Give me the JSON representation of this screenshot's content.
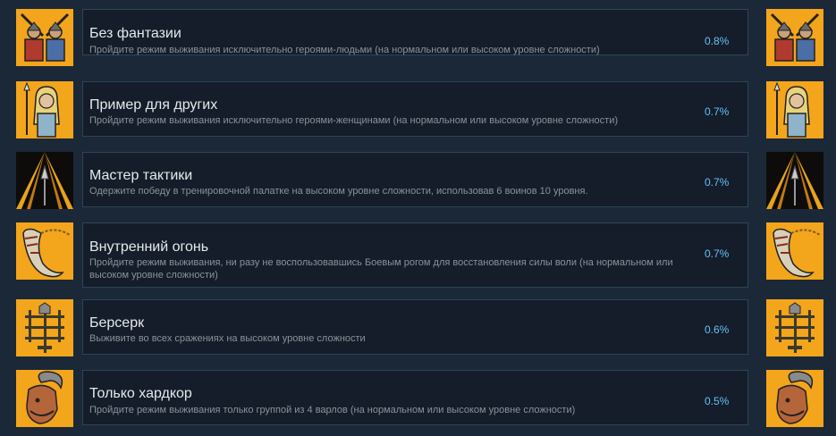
{
  "achievements": [
    {
      "title": "Без фантазии",
      "desc": "Пройдите режим выживания исключительно героями-людьми (на нормальном или высоком уровне сложности)",
      "percent": "0.8%",
      "icon": "two-warriors-icon"
    },
    {
      "title": "Пример для других",
      "desc": "Пройдите режим выживания исключительно героями-женщинами (на нормальном или высоком уровне сложности)",
      "percent": "0.7%",
      "icon": "shieldmaiden-icon"
    },
    {
      "title": "Мастер тактики",
      "desc": "Одержите победу в тренировочной палатке на высоком уровне сложности, использовав 6 воинов 10 уровня.",
      "percent": "0.7%",
      "icon": "spear-tent-icon"
    },
    {
      "title": "Внутренний огонь",
      "desc": "Пройдите режим выживания, ни разу не воспользовавшись Боевым рогом для восстановления силы воли (на нормальном или высоком уровне сложности)",
      "percent": "0.7%",
      "icon": "war-horn-icon"
    },
    {
      "title": "Берсерк",
      "desc": "Выживите во всех сражениях на высоком уровне сложности",
      "percent": "0.6%",
      "icon": "axe-rack-icon"
    },
    {
      "title": "Только хардкор",
      "desc": "Пройдите режим выживания только группой из 4 варлов (на нормальном или высоком уровне сложности)",
      "percent": "0.5%",
      "icon": "horned-varl-icon"
    }
  ],
  "colors": {
    "background": "#1b2838",
    "card": "#141d29",
    "border": "#2e4459",
    "percent": "#66c0f4",
    "icon_bg": "#f3a51c"
  }
}
